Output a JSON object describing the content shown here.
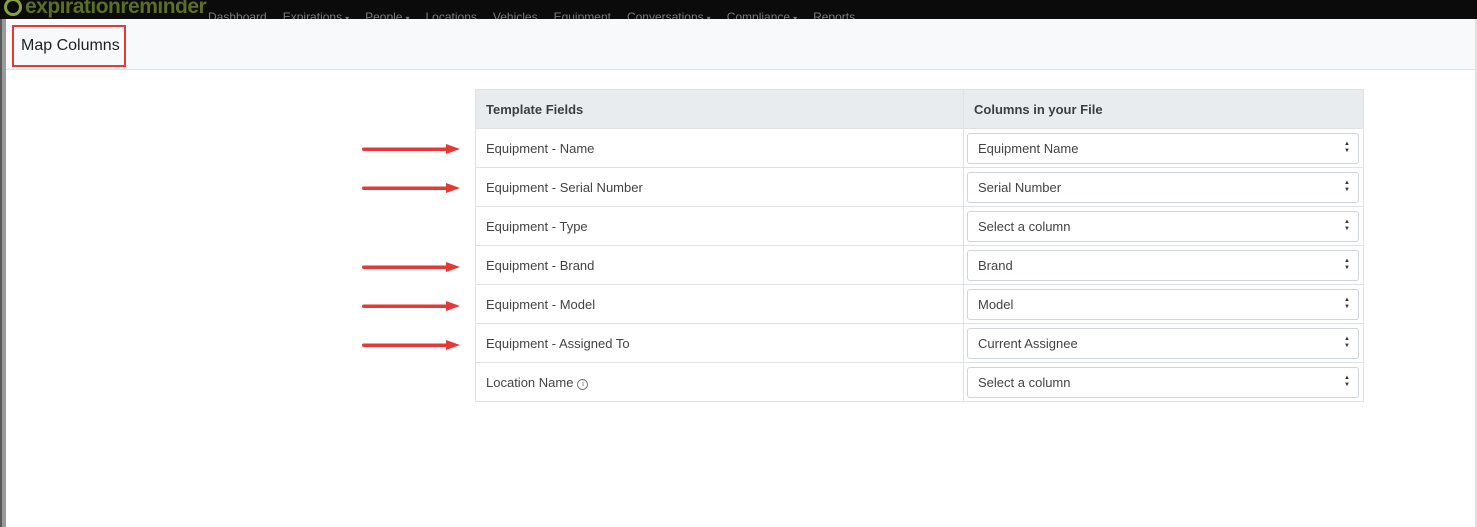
{
  "app": {
    "logo_text": "expirationreminder",
    "nav": [
      {
        "label": "Dashboard",
        "caret": false
      },
      {
        "label": "Expirations",
        "caret": true
      },
      {
        "label": "People",
        "caret": true
      },
      {
        "label": "Locations",
        "caret": false
      },
      {
        "label": "Vehicles",
        "caret": false
      },
      {
        "label": "Equipment",
        "caret": false
      },
      {
        "label": "Conversations",
        "caret": true
      },
      {
        "label": "Compliance",
        "caret": true
      },
      {
        "label": "Reports",
        "caret": false
      }
    ]
  },
  "page": {
    "title": "Map Columns"
  },
  "table": {
    "headers": {
      "fields": "Template Fields",
      "columns": "Columns in your File"
    },
    "rows": [
      {
        "field": "Equipment - Name",
        "selected": "Equipment Name",
        "arrow": true,
        "info": false
      },
      {
        "field": "Equipment - Serial Number",
        "selected": "Serial Number",
        "arrow": true,
        "info": false
      },
      {
        "field": "Equipment - Type",
        "selected": "Select a column",
        "arrow": false,
        "info": false
      },
      {
        "field": "Equipment - Brand",
        "selected": "Brand",
        "arrow": true,
        "info": false
      },
      {
        "field": "Equipment - Model",
        "selected": "Model",
        "arrow": true,
        "info": false
      },
      {
        "field": "Equipment - Assigned To",
        "selected": "Current Assignee",
        "arrow": true,
        "info": false
      },
      {
        "field": "Location Name",
        "selected": "Select a column",
        "arrow": false,
        "info": true
      }
    ]
  },
  "colors": {
    "annotation": "#e53935",
    "header_bg": "#e9ecef",
    "navbar": "#0b0b0b"
  },
  "icons": {
    "select_caret": "sort-arrows-icon",
    "info": "info-circle-icon",
    "annotation": "red-arrow-icon"
  }
}
